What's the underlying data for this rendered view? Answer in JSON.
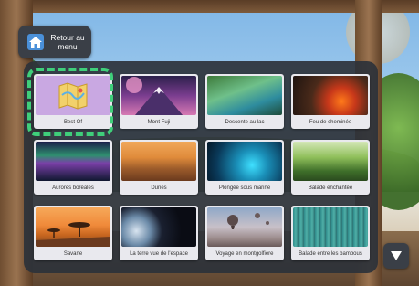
{
  "home_button": {
    "label": "Retour au menu",
    "icon": "home-icon"
  },
  "grid": {
    "selected_index": 0,
    "tiles": [
      {
        "label": "Best Of"
      },
      {
        "label": "Mont Fuji"
      },
      {
        "label": "Descente au lac"
      },
      {
        "label": "Feu de cheminée"
      },
      {
        "label": "Aurores boréales"
      },
      {
        "label": "Dunes"
      },
      {
        "label": "Plongée sous marine"
      },
      {
        "label": "Balade enchantée"
      },
      {
        "label": "Savane"
      },
      {
        "label": "La terre vue de l'espace"
      },
      {
        "label": "Voyage en montgolfière"
      },
      {
        "label": "Balade entre les bambous"
      }
    ]
  },
  "scroll_button": {
    "icon": "triangle-down-icon"
  },
  "colors": {
    "selection_ring": "#3fcf7a",
    "panel_bg": "#2d323a",
    "tile_bg": "#e9e9ee"
  }
}
